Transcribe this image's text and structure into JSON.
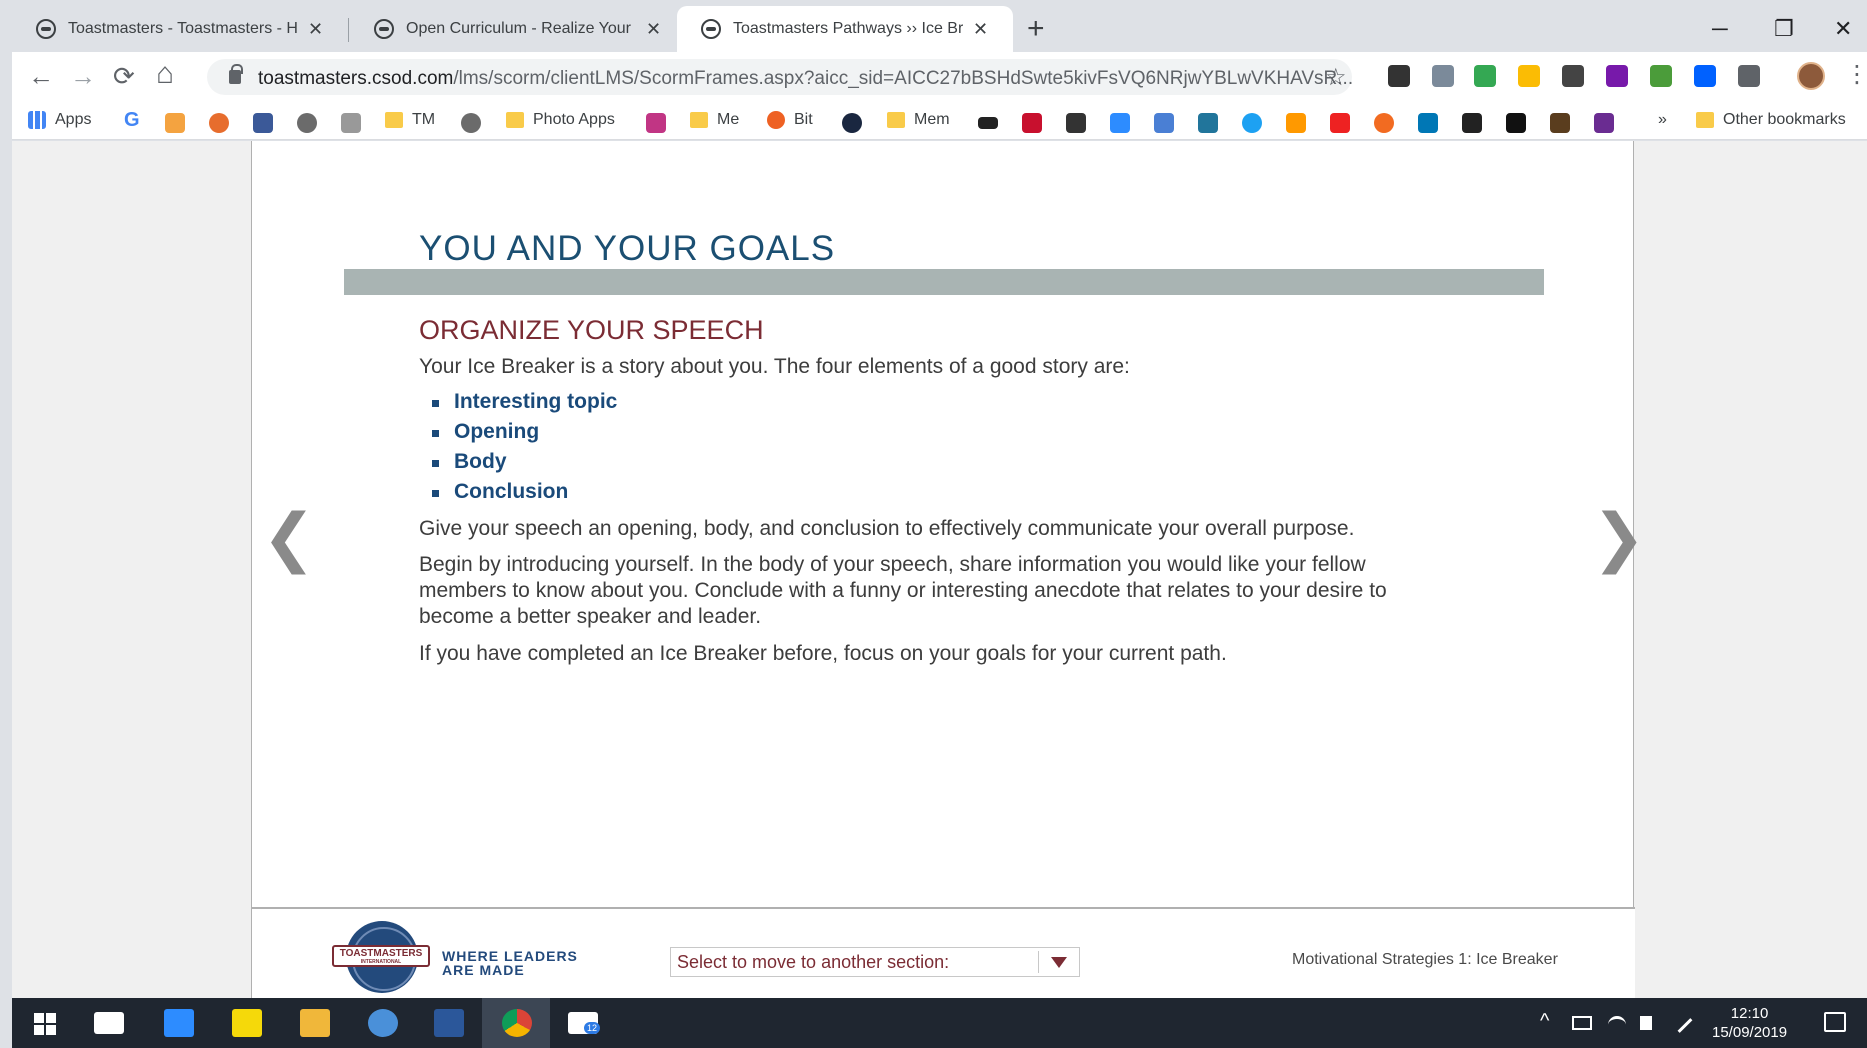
{
  "browser": {
    "tabs": [
      {
        "label": "Toastmasters - Toastmasters - Ha",
        "active": false
      },
      {
        "label": "Open Curriculum - Realize Your F",
        "active": false
      },
      {
        "label": "Toastmasters Pathways ›› Ice Brea",
        "active": true
      }
    ],
    "close_glyph": "✕",
    "new_tab_glyph": "+",
    "window_controls": {
      "minimize": "─",
      "restore": "❐",
      "close": "✕"
    },
    "nav": {
      "back": "←",
      "forward": "→",
      "reload": "⟳",
      "home": "⌂"
    },
    "url_host": "toastmasters.csod.com",
    "url_path": "/lms/scorm/clientLMS/ScormFrames.aspx?aicc_sid=AICC27bBSHdSwte5kivFsVQ6NRjwYBLwVKHAVsR...",
    "bookmark_star": "☆",
    "menu_glyph": "⋮",
    "bookmarks": {
      "apps": "Apps",
      "g": "G",
      "tm": "TM",
      "photo_apps": "Photo Apps",
      "me": "Me",
      "bit": "Bit",
      "mem": "Mem",
      "more": "»",
      "other": "Other bookmarks"
    }
  },
  "page": {
    "heading": "YOU AND YOUR GOALS",
    "subheading": "ORGANIZE YOUR SPEECH",
    "intro": "Your Ice Breaker is a story about you. The four elements of a good story are:",
    "elements": [
      "Interesting topic",
      "Opening",
      "Body",
      "Conclusion"
    ],
    "para1": "Give your speech an opening, body, and conclusion to effectively communicate your overall purpose.",
    "para2": "Begin by introducing yourself. In the body of your speech, share information you would like your fellow members to know about you. Conclude with a funny or interesting anecdote that relates to your desire to become a better speaker and leader.",
    "para3": "If you have completed an Ice Breaker before, focus on your goals for your current path.",
    "prev_glyph": "❮",
    "next_glyph": "❯"
  },
  "footer": {
    "logo_band": "TOASTMASTERS",
    "logo_sub": "INTERNATIONAL",
    "tagline": "WHERE LEADERS ARE MADE",
    "section_select": "Select to move to another section:",
    "course_title": "Motivational Strategies 1: Ice Breaker"
  },
  "taskbar": {
    "mail_badge": "12",
    "time": "12:10",
    "date": "15/09/2019",
    "tray_chevron": "^"
  },
  "colors": {
    "heading": "#1b4f72",
    "subheading": "#7b2c34",
    "bullet": "#1a4a7a",
    "gray_bar": "#a9b4b3"
  }
}
